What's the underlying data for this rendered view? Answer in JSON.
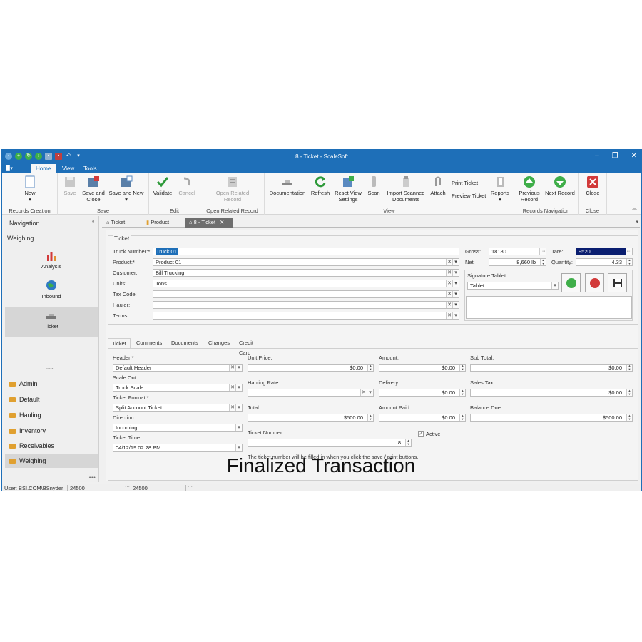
{
  "window": {
    "title": "8 - Ticket - ScaleSoft",
    "minimize": "–",
    "restore": "❐",
    "close": "✕",
    "accent": "#1e6fb8"
  },
  "menu": {
    "app_button": "▉▾",
    "tabs": [
      "Home",
      "View",
      "Tools"
    ]
  },
  "ribbon": {
    "records_creation": {
      "label": "Records Creation",
      "new": "New",
      "new_arrow": "▾"
    },
    "save": {
      "label": "Save",
      "save": "Save",
      "save_and_close_1": "Save and",
      "save_and_close_2": "Close",
      "save_and_new": "Save and New",
      "save_and_new_arrow": "▾"
    },
    "edit": {
      "label": "Edit",
      "validate": "Validate",
      "cancel": "Cancel"
    },
    "open_related": {
      "label": "Open Related Record",
      "btn_1": "Open Related",
      "btn_2": "Record"
    },
    "view": {
      "label": "View",
      "documentation": "Documentation",
      "refresh": "Refresh",
      "reset_1": "Reset View",
      "reset_2": "Settings",
      "scan": "Scan",
      "import_1": "Import Scanned",
      "import_2": "Documents",
      "attach": "Attach",
      "print_ticket": "Print Ticket",
      "preview_ticket": "Preview Ticket",
      "reports": "Reports",
      "reports_arrow": "▾"
    },
    "records_navigation": {
      "label": "Records Navigation",
      "prev_1": "Previous",
      "prev_2": "Record",
      "next": "Next Record"
    },
    "close": {
      "label": "Close",
      "close": "Close"
    },
    "collapse": "︽"
  },
  "nav": {
    "title": "Navigation",
    "pin": "ª",
    "section": "Weighing",
    "items": [
      {
        "label": "Analysis",
        "icon": "bar-chart-icon"
      },
      {
        "label": "Inbound",
        "icon": "globe-icon"
      },
      {
        "label": "Ticket",
        "icon": "scale-icon"
      }
    ],
    "dots": ".....",
    "groups": [
      "Admin",
      "Default",
      "Hauling",
      "Inventory",
      "Receivables",
      "Weighing"
    ],
    "more": "•••"
  },
  "doc_tabs": {
    "tabs": [
      "Ticket",
      "Product",
      "8 - Ticket"
    ],
    "close": "✕",
    "arrow": "▾"
  },
  "ticket": {
    "group_title": "Ticket",
    "labels": {
      "truck_number": "Truck Number:*",
      "product": "Product:*",
      "customer": "Customer:",
      "units": "Units:",
      "tax_code": "Tax Code:",
      "hauler": "Hauler:",
      "terms": "Terms:"
    },
    "values": {
      "truck_number": "Truck 01",
      "product": "Product 01",
      "customer": "Bill Trucking",
      "units": "Tons",
      "tax_code": "",
      "hauler": "",
      "terms": ""
    },
    "weights": {
      "gross_label": "Gross:",
      "gross": "18180",
      "tare_label": "Tare:",
      "tare": "9520",
      "net_label": "Net:",
      "net": "8,660 lb",
      "quantity_label": "Quantity:",
      "quantity": "4.33"
    },
    "signature": {
      "label": "Signature Tablet",
      "device": "Tablet"
    },
    "clear": "✕",
    "dropdown": "▾",
    "ellipsis": "···",
    "spin_up": "▲",
    "spin_down": "▼"
  },
  "sub_tabs": [
    "Ticket",
    "Comments",
    "Documents",
    "Changes",
    "Credit Card"
  ],
  "detail": {
    "header_label": "Header:*",
    "header": "Default Header",
    "scale_out_label": "Scale Out:",
    "scale_out": "Truck Scale",
    "ticket_format_label": "Ticket Format:*",
    "ticket_format": "Split Account Ticket",
    "direction_label": "Direction:",
    "direction": "Incoming",
    "ticket_time_label": "Ticket Time:",
    "ticket_time": "04/12/19 02:28 PM",
    "unit_price_label": "Unit Price:",
    "unit_price": "$0.00",
    "hauling_rate_label": "Hauling Rate:",
    "hauling_rate": "",
    "total_label": "Total:",
    "total": "$500.00",
    "ticket_number_label": "Ticket Number:",
    "ticket_number": "8",
    "amount_label": "Amount:",
    "amount": "$0.00",
    "delivery_label": "Delivery:",
    "delivery": "$0.00",
    "amount_paid_label": "Amount Paid:",
    "amount_paid": "$0.00",
    "active_label": "Active",
    "active_check": "✓",
    "sub_total_label": "Sub Total:",
    "sub_total": "$0.00",
    "sales_tax_label": "Sales Tax:",
    "sales_tax": "$0.00",
    "balance_due_label": "Balance Due:",
    "balance_due": "$500.00",
    "note": "The ticket number will be filled in when you click the save / print buttons."
  },
  "overlay_title": "Finalized Transaction",
  "status": {
    "user": "User: BSI.COM\\BSnyder",
    "value1": "24500",
    "value2": "24500",
    "dots": "···"
  }
}
